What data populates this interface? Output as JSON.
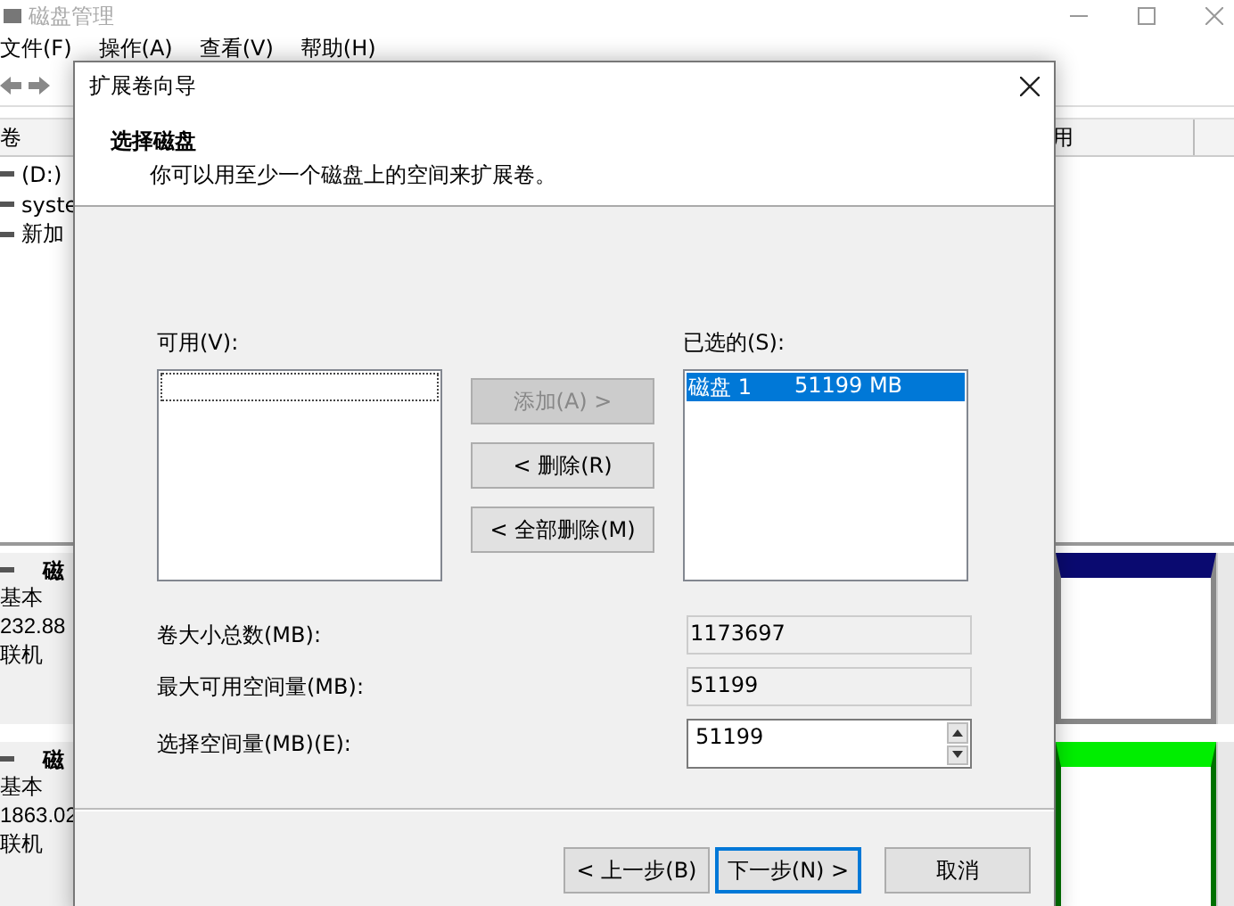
{
  "background_window": {
    "title": "磁盘管理",
    "menu": [
      "文件(F)",
      "操作(A)",
      "查看(V)",
      "帮助(H)"
    ],
    "column_1": "卷",
    "column_2": "用",
    "volumes": [
      "(D:)",
      "syste",
      "新加"
    ],
    "disks": [
      {
        "name": "磁",
        "type": "基本",
        "size": "232.88",
        "status": "联机"
      },
      {
        "name": "磁",
        "type": "基本",
        "size": "1863.02",
        "status": "联机"
      }
    ]
  },
  "dialog": {
    "title": "扩展卷向导",
    "heading": "选择磁盘",
    "subtitle": "你可以用至少一个磁盘上的空间来扩展卷。",
    "available_label": "可用(V):",
    "selected_label": "已选的(S):",
    "selected_disks": [
      {
        "disk": "磁盘 1",
        "size": "51199 MB",
        "selected": true
      }
    ],
    "move_buttons": [
      {
        "label": "添加(A) >",
        "disabled": true
      },
      {
        "label": "< 删除(R)",
        "disabled": false
      },
      {
        "label": "< 全部删除(M)",
        "disabled": false
      }
    ],
    "fields": [
      {
        "label": "卷大小总数(MB):",
        "value": "1173697",
        "kind": "readonly"
      },
      {
        "label": "最大可用空间量(MB):",
        "value": "51199",
        "kind": "readonly"
      },
      {
        "label": "选择空间量(MB)(E):",
        "value": "51199",
        "kind": "spin"
      }
    ],
    "footer_buttons": [
      {
        "label": "< 上一步(B)",
        "default": false
      },
      {
        "label": "下一步(N) >",
        "default": true
      },
      {
        "label": "取消",
        "default": false
      }
    ]
  }
}
